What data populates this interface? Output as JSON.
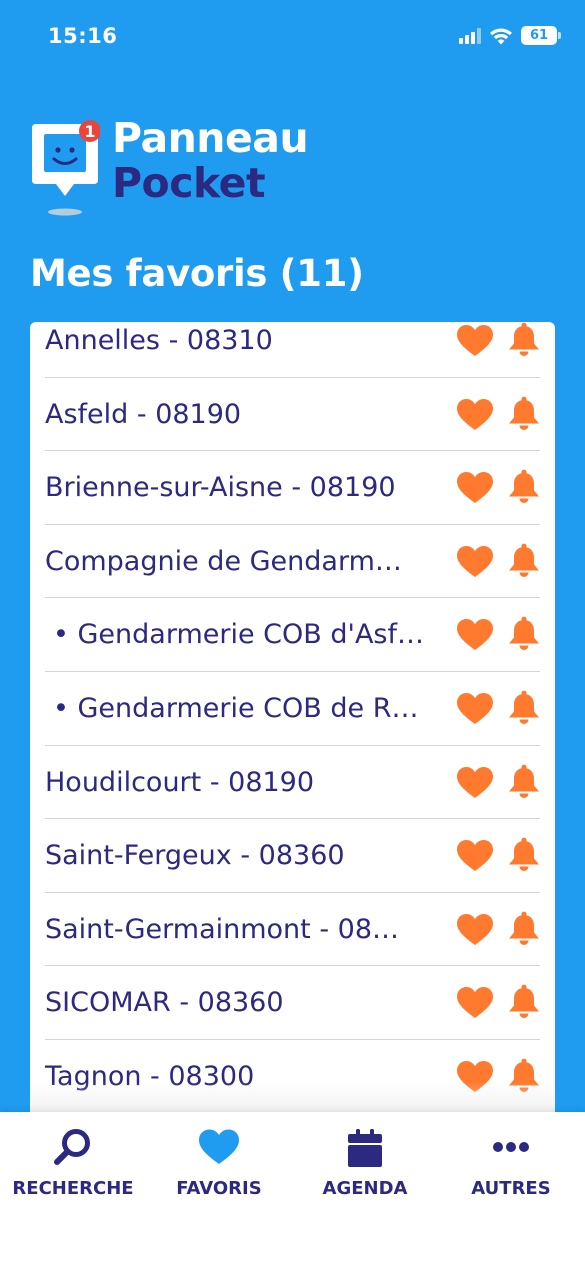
{
  "status_bar": {
    "time": "15:16",
    "battery": "61"
  },
  "logo": {
    "badge_count": "1",
    "line1": "Panneau",
    "line2": "Pocket"
  },
  "page_title": "Mes favoris (11)",
  "favorites": [
    {
      "name": "Annelles - 08310",
      "sub": false
    },
    {
      "name": "Asfeld - 08190",
      "sub": false
    },
    {
      "name": "Brienne-sur-Aisne - 08190",
      "sub": false
    },
    {
      "name": "Compagnie de Gendarm…",
      "sub": false
    },
    {
      "name": "• Gendarmerie COB d'Asf…",
      "sub": true
    },
    {
      "name": "• Gendarmerie COB de R…",
      "sub": true
    },
    {
      "name": "Houdilcourt - 08190",
      "sub": false
    },
    {
      "name": "Saint-Fergeux - 08360",
      "sub": false
    },
    {
      "name": "Saint-Germainmont - 08…",
      "sub": false
    },
    {
      "name": "SICOMAR - 08360",
      "sub": false
    },
    {
      "name": "Tagnon - 08300",
      "sub": false
    }
  ],
  "tabs": [
    {
      "label": "RECHERCHE",
      "icon": "search-icon"
    },
    {
      "label": "FAVORIS",
      "icon": "heart-icon"
    },
    {
      "label": "AGENDA",
      "icon": "calendar-icon"
    },
    {
      "label": "AUTRES",
      "icon": "more-icon"
    }
  ],
  "colors": {
    "background": "#1f9bf0",
    "brand_dark": "#2b2a80",
    "accent_orange": "#ff7a2f",
    "badge_red": "#e8453c"
  }
}
